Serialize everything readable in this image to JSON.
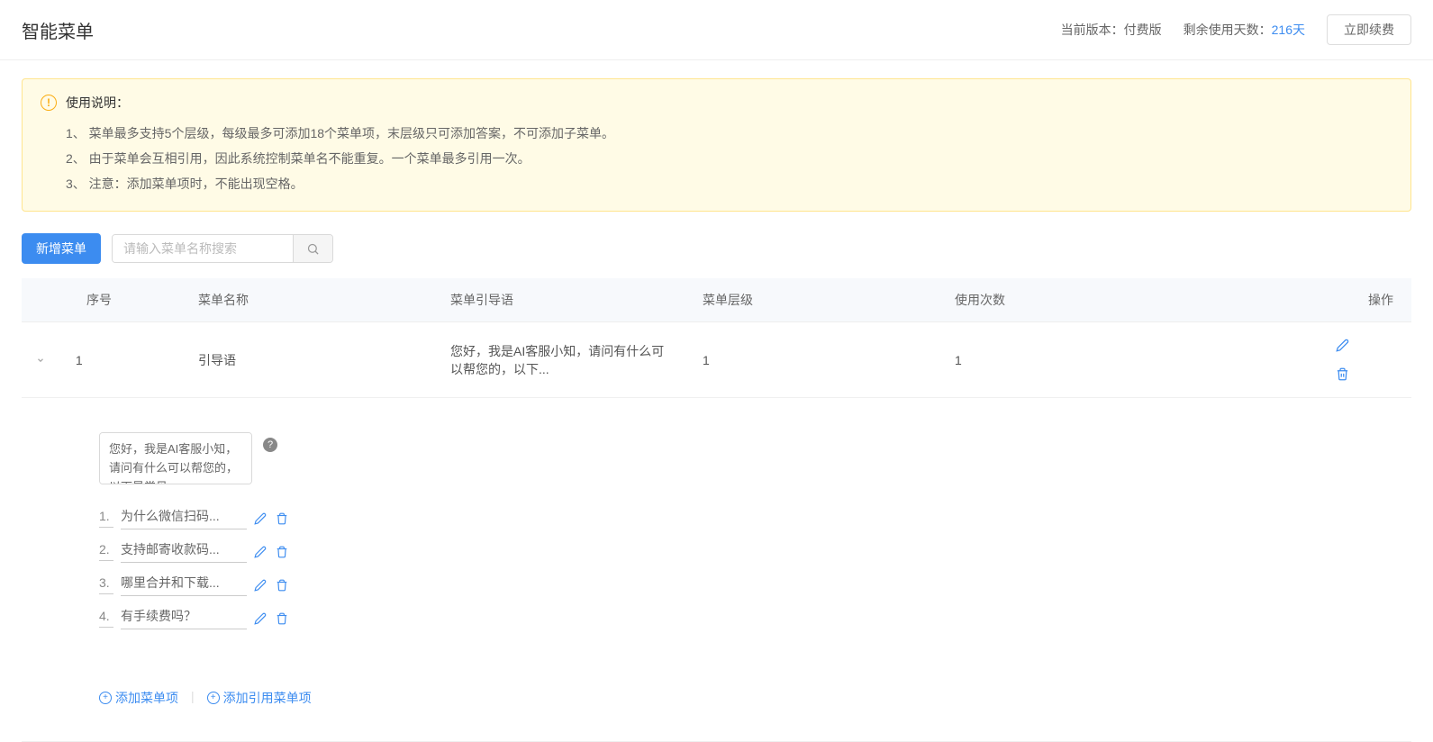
{
  "header": {
    "title": "智能菜单",
    "version_label": "当前版本：",
    "version_value": "付费版",
    "days_label": "剩余使用天数：",
    "days_value": "216天",
    "renew_button": "立即续费"
  },
  "alert": {
    "title": "使用说明：",
    "items": [
      "1、 菜单最多支持5个层级，每级最多可添加18个菜单项，末层级只可添加答案，不可添加子菜单。",
      "2、 由于菜单会互相引用，因此系统控制菜单名不能重复。一个菜单最多引用一次。",
      "3、 注意：添加菜单项时，不能出现空格。"
    ]
  },
  "toolbar": {
    "add_button": "新增菜单",
    "search_placeholder": "请输入菜单名称搜索"
  },
  "table": {
    "headers": {
      "index": "序号",
      "name": "菜单名称",
      "guide": "菜单引导语",
      "level": "菜单层级",
      "count": "使用次数",
      "action": "操作"
    },
    "rows": [
      {
        "index": "1",
        "name": "引导语",
        "guide": "您好，我是AI客服小知，请问有什么可以帮您的，以下...",
        "level": "1",
        "count": "1"
      }
    ]
  },
  "detail": {
    "guide_text": "您好，我是AI客服小知，请问有什么可以帮您的，以下是常见",
    "items": [
      {
        "num": "1.",
        "text": "为什么微信扫码..."
      },
      {
        "num": "2.",
        "text": "支持邮寄收款码..."
      },
      {
        "num": "3.",
        "text": "哪里合并和下载..."
      },
      {
        "num": "4.",
        "text": "有手续费吗？"
      }
    ],
    "add_item": "添加菜单项",
    "add_ref": "添加引用菜单项"
  }
}
